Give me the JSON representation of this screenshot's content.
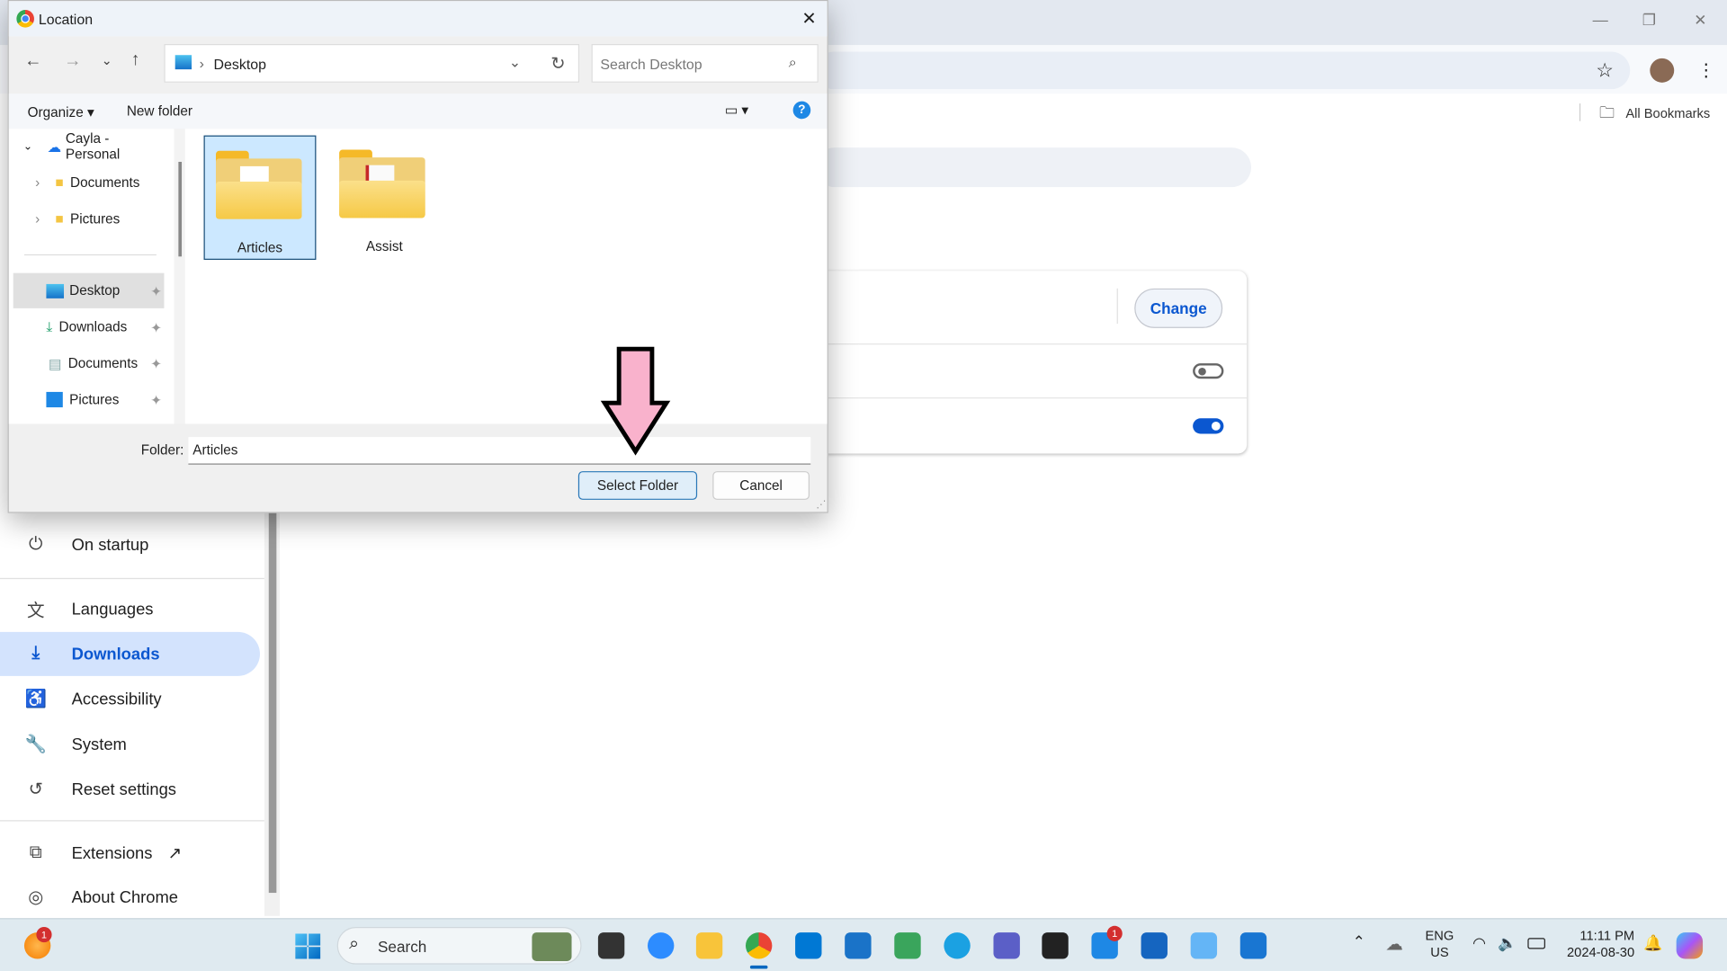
{
  "browser": {
    "all_bookmarks": "All Bookmarks",
    "change_button": "Change",
    "toggle1_on": false,
    "toggle2_on": true,
    "accent": "#0b57d0"
  },
  "settings_nav": [
    {
      "label": "On startup",
      "icon": "power-icon",
      "glyph": "⏻"
    },
    {
      "label": "Languages",
      "icon": "translate-icon",
      "glyph": "文"
    },
    {
      "label": "Downloads",
      "icon": "download-icon",
      "glyph": "⤓",
      "selected": true
    },
    {
      "label": "Accessibility",
      "icon": "accessibility-icon",
      "glyph": "♿"
    },
    {
      "label": "System",
      "icon": "wrench-icon",
      "glyph": "🔧"
    },
    {
      "label": "Reset settings",
      "icon": "reset-icon",
      "glyph": "↺"
    },
    {
      "label": "Extensions",
      "icon": "extension-icon",
      "glyph": "⧉"
    },
    {
      "label": "About Chrome",
      "icon": "chrome-icon",
      "glyph": "◎"
    }
  ],
  "dialog": {
    "title": "Location",
    "path": "Desktop",
    "search_placeholder": "Search Desktop",
    "organize": "Organize",
    "new_folder": "New folder",
    "tree": [
      {
        "label": "Cayla - Personal",
        "expanded": true
      },
      {
        "label": "Documents"
      },
      {
        "label": "Pictures"
      }
    ],
    "quick_access": [
      {
        "label": "Desktop",
        "selected": true
      },
      {
        "label": "Downloads"
      },
      {
        "label": "Documents"
      },
      {
        "label": "Pictures"
      }
    ],
    "files": [
      {
        "name": "Articles",
        "selected": true
      },
      {
        "name": "Assist"
      }
    ],
    "folder_label": "Folder:",
    "folder_value": "Articles",
    "select_button": "Select Folder",
    "cancel_button": "Cancel"
  },
  "taskbar": {
    "search_label": "Search",
    "lang1": "ENG",
    "lang2": "US",
    "time": "11:11 PM",
    "date": "2024-08-30",
    "badge_left": "1",
    "badge_app": "1"
  }
}
